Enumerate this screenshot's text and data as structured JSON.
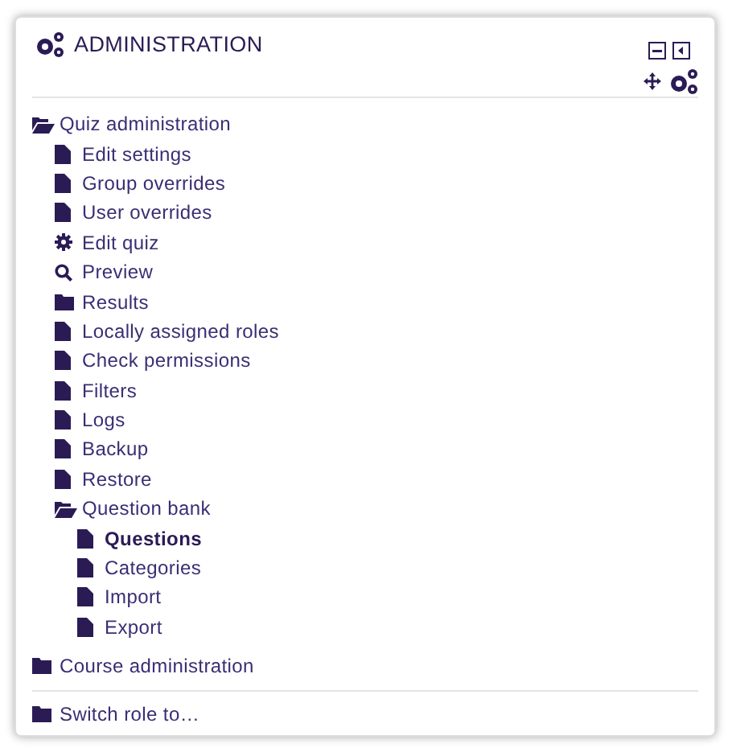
{
  "block": {
    "title": "ADMINISTRATION"
  },
  "tree": [
    {
      "label": "Quiz administration",
      "kind": "folder",
      "expanded": true,
      "selected": false,
      "children": [
        {
          "label": "Edit settings",
          "kind": "file",
          "selected": false
        },
        {
          "label": "Group overrides",
          "kind": "file",
          "selected": false
        },
        {
          "label": "User overrides",
          "kind": "file",
          "selected": false
        },
        {
          "label": "Edit quiz",
          "kind": "gear",
          "selected": false
        },
        {
          "label": "Preview",
          "kind": "search",
          "selected": false
        },
        {
          "label": "Results",
          "kind": "folder",
          "expanded": false,
          "selected": false
        },
        {
          "label": "Locally assigned roles",
          "kind": "file",
          "selected": false
        },
        {
          "label": "Check permissions",
          "kind": "file",
          "selected": false
        },
        {
          "label": "Filters",
          "kind": "file",
          "selected": false
        },
        {
          "label": "Logs",
          "kind": "file",
          "selected": false
        },
        {
          "label": "Backup",
          "kind": "file",
          "selected": false
        },
        {
          "label": "Restore",
          "kind": "file",
          "selected": false
        },
        {
          "label": "Question bank",
          "kind": "folder",
          "expanded": true,
          "selected": false,
          "children": [
            {
              "label": "Questions",
              "kind": "file",
              "selected": true
            },
            {
              "label": "Categories",
              "kind": "file",
              "selected": false
            },
            {
              "label": "Import",
              "kind": "file",
              "selected": false
            },
            {
              "label": "Export",
              "kind": "file",
              "selected": false
            }
          ]
        }
      ]
    },
    {
      "label": "Course administration",
      "kind": "folder",
      "expanded": false,
      "selected": false
    },
    {
      "label": "Switch role to…",
      "kind": "folder",
      "expanded": false,
      "selected": false
    }
  ]
}
